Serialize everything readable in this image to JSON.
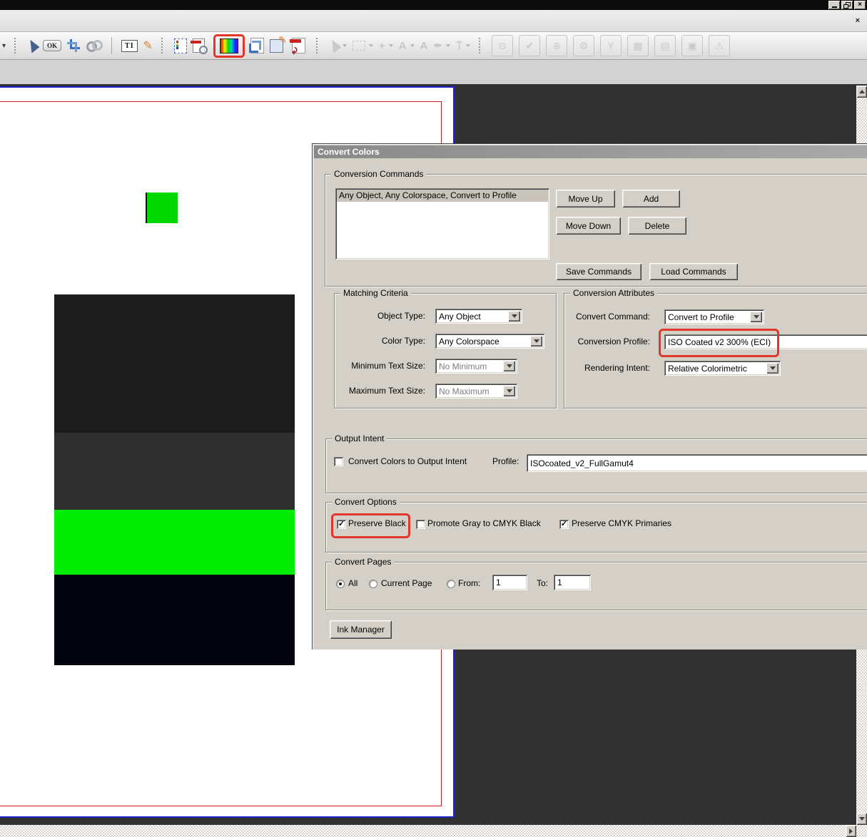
{
  "window": {
    "controls": {
      "minimize": "minimize",
      "restore": "restore",
      "close": "×"
    },
    "toolbar_close": "×"
  },
  "toolbar": {
    "ok_label": "OK",
    "ti_label": "TI",
    "items": [
      {
        "name": "overflow-caret-icon",
        "kind": "caret",
        "interactable": true
      },
      {
        "name": "toolbar-grip",
        "kind": "grip",
        "interactable": false
      },
      {
        "name": "select-tool-icon",
        "kind": "arrow",
        "interactable": true
      },
      {
        "name": "ok-stamp-icon",
        "kind": "ok",
        "interactable": true
      },
      {
        "name": "crop-tool-icon",
        "kind": "crop",
        "interactable": true
      },
      {
        "name": "link-tool-icon",
        "kind": "link",
        "interactable": true
      },
      {
        "name": "toolbar-separator",
        "kind": "sep",
        "interactable": false
      },
      {
        "name": "touchup-text-icon",
        "kind": "ti",
        "interactable": true
      },
      {
        "name": "touchup-object-icon",
        "kind": "glyph",
        "glyph": "✎",
        "color": "#d9822b",
        "interactable": true
      },
      {
        "name": "toolbar-grip",
        "kind": "grip",
        "interactable": false
      },
      {
        "name": "object-select-icon",
        "kind": "objsel",
        "interactable": true
      },
      {
        "name": "output-preview-icon",
        "kind": "printprev",
        "interactable": true
      },
      {
        "name": "convert-colors-icon",
        "kind": "rainbow",
        "annotated": true,
        "interactable": true
      },
      {
        "name": "crop-pages-icon",
        "kind": "croppage",
        "interactable": true
      },
      {
        "name": "edit-form-icon",
        "kind": "formedit",
        "interactable": true
      },
      {
        "name": "pdf-convert-icon",
        "kind": "pdfconv",
        "interactable": true
      },
      {
        "name": "toolbar-grip",
        "kind": "grip",
        "interactable": false
      },
      {
        "name": "select-tool-ghost-icon",
        "kind": "ghostarrow",
        "caret": true,
        "interactable": true
      },
      {
        "name": "marquee-ghost-icon",
        "kind": "ghostbox",
        "caret": true,
        "interactable": true
      },
      {
        "name": "move-ghost-icon",
        "kind": "ghost",
        "glyph": "+",
        "caret": true,
        "interactable": true
      },
      {
        "name": "text-tool-ghost-icon",
        "kind": "ghost",
        "glyph": "A",
        "caret": true,
        "interactable": true
      },
      {
        "name": "font-tool-ghost-icon",
        "kind": "ghost",
        "glyph": "A",
        "interactable": true
      },
      {
        "name": "pen-tool-ghost-icon",
        "kind": "ghost",
        "glyph": "✒",
        "caret": true,
        "interactable": true
      },
      {
        "name": "stamp-tool-ghost-icon",
        "kind": "ghost",
        "glyph": "⍑",
        "caret": true,
        "interactable": true
      },
      {
        "name": "toolbar-grip",
        "kind": "grip",
        "interactable": false
      },
      {
        "name": "search-ghost-button",
        "kind": "frame",
        "glyph": "⊙",
        "interactable": true
      },
      {
        "name": "check-ghost-button",
        "kind": "frame",
        "glyph": "✔",
        "interactable": true
      },
      {
        "name": "web-ghost-button",
        "kind": "frame",
        "glyph": "⊕",
        "interactable": true
      },
      {
        "name": "settings-ghost-button",
        "kind": "frame",
        "glyph": "⚙",
        "interactable": true
      },
      {
        "name": "share-ghost-button",
        "kind": "frame",
        "glyph": "Y",
        "interactable": true
      },
      {
        "name": "layout-ghost-button",
        "kind": "frame",
        "glyph": "▦",
        "interactable": true
      },
      {
        "name": "export-page-ghost-button",
        "kind": "frame",
        "glyph": "▤",
        "interactable": true
      },
      {
        "name": "snapshot-ghost-button",
        "kind": "frame",
        "glyph": "▣",
        "interactable": true
      },
      {
        "name": "warning-ghost-button",
        "kind": "frame",
        "glyph": "⚠",
        "interactable": true
      }
    ]
  },
  "dialog": {
    "title": "Convert Colors",
    "conversion_commands": {
      "label": "Conversion Commands",
      "items": [
        "Any Object, Any Colorspace, Convert to Profile"
      ],
      "buttons": {
        "move_up": "Move Up",
        "add": "Add",
        "move_down": "Move Down",
        "delete": "Delete",
        "save": "Save Commands",
        "load": "Load Commands"
      }
    },
    "matching_criteria": {
      "label": "Matching Criteria",
      "object_type": {
        "label": "Object Type:",
        "value": "Any Object"
      },
      "color_type": {
        "label": "Color Type:",
        "value": "Any Colorspace"
      },
      "min_text": {
        "label": "Minimum Text Size:",
        "value": "No Minimum",
        "disabled": true
      },
      "max_text": {
        "label": "Maximum Text Size:",
        "value": "No Maximum",
        "disabled": true
      }
    },
    "conversion_attributes": {
      "label": "Conversion Attributes",
      "convert_command": {
        "label": "Convert Command:",
        "value": "Convert to Profile"
      },
      "conversion_profile": {
        "label": "Conversion Profile:",
        "value": "ISO Coated v2 300% (ECI)",
        "highlighted": true
      },
      "rendering_intent": {
        "label": "Rendering Intent:",
        "value": "Relative Colorimetric"
      }
    },
    "output_intent": {
      "label": "Output Intent",
      "checkbox_label": "Convert Colors to Output Intent",
      "checked": false,
      "profile_label": "Profile:",
      "profile_value": "ISOcoated_v2_FullGamut4"
    },
    "convert_options": {
      "label": "Convert Options",
      "preserve_black": {
        "label": "Preserve Black",
        "checked": true,
        "highlighted": true
      },
      "promote_gray": {
        "label": "Promote Gray to CMYK Black",
        "checked": false
      },
      "preserve_cmyk": {
        "label": "Preserve CMYK Primaries",
        "checked": true
      }
    },
    "convert_pages": {
      "label": "Convert Pages",
      "all_label": "All",
      "all_selected": true,
      "current_page_label": "Current Page",
      "from_label": "From:",
      "from_value": "1",
      "to_label": "To:",
      "to_value": "1"
    },
    "ink_manager_label": "Ink Manager"
  },
  "document_page": {
    "shapes": [
      "green-square",
      "dark-gray-bar",
      "gray-bar",
      "green-bar",
      "black-bar"
    ],
    "colors": {
      "green_square": "#00d900",
      "bar_dark_gray": "#1d1d1d",
      "bar_gray": "#302f30",
      "bar_green": "#00ec00",
      "bar_black": "#030310",
      "trim_line": "#d01b1b",
      "page_border": "#2121c8"
    }
  },
  "annotation_color": "#e1372b"
}
